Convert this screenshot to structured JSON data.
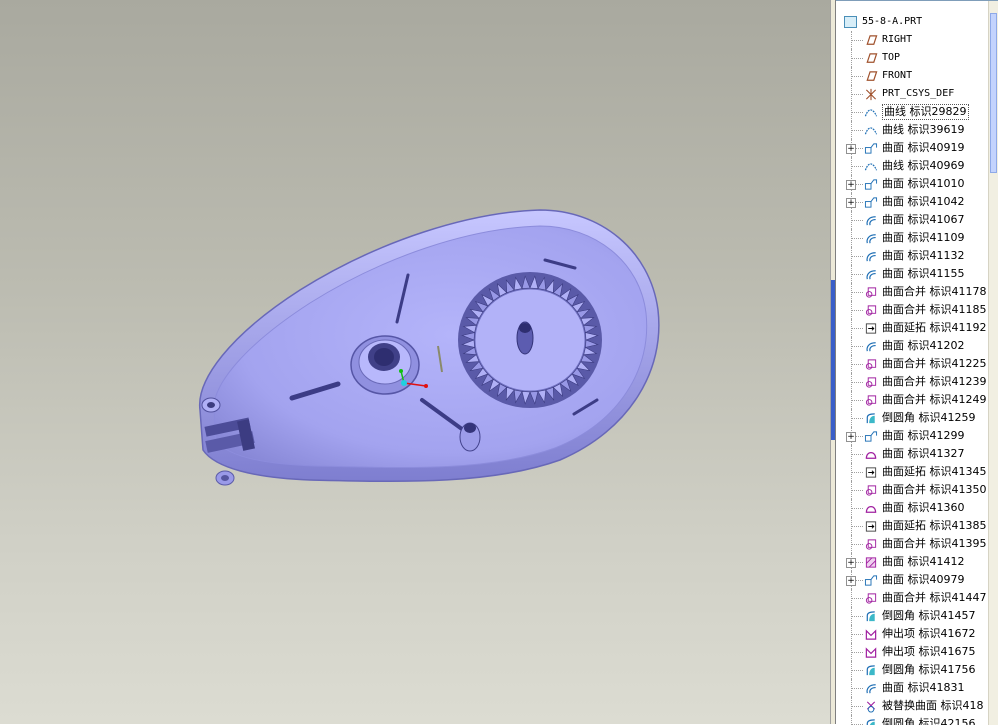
{
  "model_tree": {
    "root": {
      "label": "55-8-A.PRT",
      "icon": "part-icon"
    },
    "items": [
      {
        "label": "RIGHT",
        "icon": "datum-plane-icon",
        "expandable": false
      },
      {
        "label": "TOP",
        "icon": "datum-plane-icon",
        "expandable": false
      },
      {
        "label": "FRONT",
        "icon": "datum-plane-icon",
        "expandable": false
      },
      {
        "label": "PRT_CSYS_DEF",
        "icon": "csys-icon",
        "expandable": false
      },
      {
        "label": "曲线 标识29829",
        "icon": "curve-icon",
        "expandable": false,
        "highlighted": true
      },
      {
        "label": "曲线 标识39619",
        "icon": "curve-icon",
        "expandable": false
      },
      {
        "label": "曲面 标识40919",
        "icon": "surface-icon",
        "expandable": true
      },
      {
        "label": "曲线 标识40969",
        "icon": "curve-icon",
        "expandable": false
      },
      {
        "label": "曲面 标识41010",
        "icon": "surface-icon",
        "expandable": true
      },
      {
        "label": "曲面 标识41042",
        "icon": "surface-icon",
        "expandable": true
      },
      {
        "label": "曲面 标识41067",
        "icon": "sweep-surface-icon",
        "expandable": false
      },
      {
        "label": "曲面 标识41109",
        "icon": "sweep-surface-icon",
        "expandable": false
      },
      {
        "label": "曲面 标识41132",
        "icon": "sweep-surface-icon",
        "expandable": false
      },
      {
        "label": "曲面 标识41155",
        "icon": "sweep-surface-icon",
        "expandable": false
      },
      {
        "label": "曲面合并 标识41178",
        "icon": "merge-icon",
        "expandable": false
      },
      {
        "label": "曲面合并 标识41185",
        "icon": "merge-icon",
        "expandable": false
      },
      {
        "label": "曲面延拓 标识41192",
        "icon": "extend-icon",
        "expandable": false
      },
      {
        "label": "曲面 标识41202",
        "icon": "sweep-surface-icon",
        "expandable": false
      },
      {
        "label": "曲面合并 标识41225",
        "icon": "merge-icon",
        "expandable": false
      },
      {
        "label": "曲面合并 标识41239",
        "icon": "merge-icon",
        "expandable": false
      },
      {
        "label": "曲面合并 标识41249",
        "icon": "merge-icon",
        "expandable": false
      },
      {
        "label": "倒圆角 标识41259",
        "icon": "round-icon",
        "expandable": false
      },
      {
        "label": "曲面 标识41299",
        "icon": "surface-icon",
        "expandable": true
      },
      {
        "label": "曲面 标识41327",
        "icon": "boundary-surface-icon",
        "expandable": false
      },
      {
        "label": "曲面延拓 标识41345",
        "icon": "extend-icon",
        "expandable": false
      },
      {
        "label": "曲面合并 标识41350",
        "icon": "merge-icon",
        "expandable": false
      },
      {
        "label": "曲面 标识41360",
        "icon": "boundary-surface-icon",
        "expandable": false
      },
      {
        "label": "曲面延拓 标识41385",
        "icon": "extend-icon",
        "expandable": false
      },
      {
        "label": "曲面合并 标识41395",
        "icon": "merge-icon",
        "expandable": false
      },
      {
        "label": "曲面 标识41412",
        "icon": "fill-surface-icon",
        "expandable": true
      },
      {
        "label": "曲面 标识40979",
        "icon": "surface-icon",
        "expandable": true
      },
      {
        "label": "曲面合并 标识41447",
        "icon": "merge-icon",
        "expandable": false
      },
      {
        "label": "倒圆角 标识41457",
        "icon": "round-icon",
        "expandable": false
      },
      {
        "label": "伸出项 标识41672",
        "icon": "protrusion-icon",
        "expandable": false
      },
      {
        "label": "伸出项 标识41675",
        "icon": "protrusion-icon",
        "expandable": false
      },
      {
        "label": "倒圆角 标识41756",
        "icon": "round-icon",
        "expandable": false
      },
      {
        "label": "曲面 标识41831",
        "icon": "sweep-surface-icon",
        "expandable": false
      },
      {
        "label": "被替换曲面 标识418",
        "icon": "replace-surface-icon",
        "expandable": false
      },
      {
        "label": "倒圆角 标识42156",
        "icon": "round-icon",
        "expandable": false
      }
    ]
  },
  "viewport": {
    "model_color": "#a8a8f4",
    "background_top": "#a9a99f",
    "background_bottom": "#dcdcd2"
  }
}
